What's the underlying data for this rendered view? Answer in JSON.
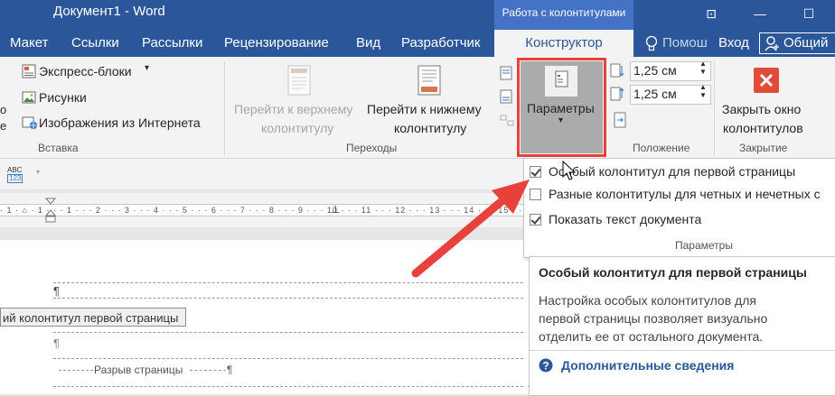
{
  "window": {
    "title": "Документ1 - Word",
    "context_tab": "Работа с колонтитулами",
    "buttons": [
      "⊡",
      "—",
      "☐",
      "✕"
    ]
  },
  "tabs": {
    "items": [
      "Макет",
      "Ссылки",
      "Рассылки",
      "Рецензирование",
      "Вид",
      "Разработчик"
    ],
    "active": "Конструктор",
    "help": "Помош",
    "login": "Вход",
    "share": "Общий"
  },
  "ribbon": {
    "insert": {
      "express_blocks": "Экспресс-блоки",
      "pictures": "Рисунки",
      "online_pictures": "Изображения из Интернета",
      "group": "Вставка"
    },
    "transitions": {
      "go_header_l1": "Перейти к верхнему",
      "go_header_l2": "колонтитулу",
      "go_footer_l1": "Перейти к нижнему",
      "go_footer_l2": "колонтитулу",
      "group": "Переходы"
    },
    "params_button": "Параметры",
    "position": {
      "header_value": "1,25 см",
      "footer_value": "1,25 см",
      "group": "Положение"
    },
    "close": {
      "label_l1": "Закрыть окно",
      "label_l2": "колонтитулов",
      "group": "Закрытие"
    }
  },
  "qat": {
    "abc": "ABC",
    "num": "123"
  },
  "ruler": {
    "text": "· 1 · ⌂ · 1 · · · 1 · · · 2 · · · 3 · · · 4 · · · 5 · · · 6 · · · 7 · · · 8 · · · 9 · · · 10 · · · 11 · · · 12 · · · 13 · · · 14 · · · 15 · · · 16 · · ·"
  },
  "document": {
    "pilcrow": "¶",
    "header_label": "ий колонтитул первой страницы",
    "page_break": "Разрыв страницы"
  },
  "dropdown": {
    "options": [
      {
        "label": "Особый колонтитул для первой страницы",
        "checked": true
      },
      {
        "label": "Разные колонтитулы для четных и нечетных с",
        "checked": false
      },
      {
        "label": "Показать текст документа",
        "checked": true
      }
    ],
    "group": "Параметры"
  },
  "tooltip": {
    "title": "Особый колонтитул для первой страницы",
    "body_l1": "Настройка особых колонтитулов для",
    "body_l2": "первой страницы позволяет визуально",
    "body_l3": "отделить ее от остального документа.",
    "more": "Дополнительные сведения"
  },
  "colors": {
    "word_blue": "#2b579a",
    "context_blue": "#4472c4",
    "highlight_red": "#e8403a",
    "close_red": "#e04b3a"
  }
}
